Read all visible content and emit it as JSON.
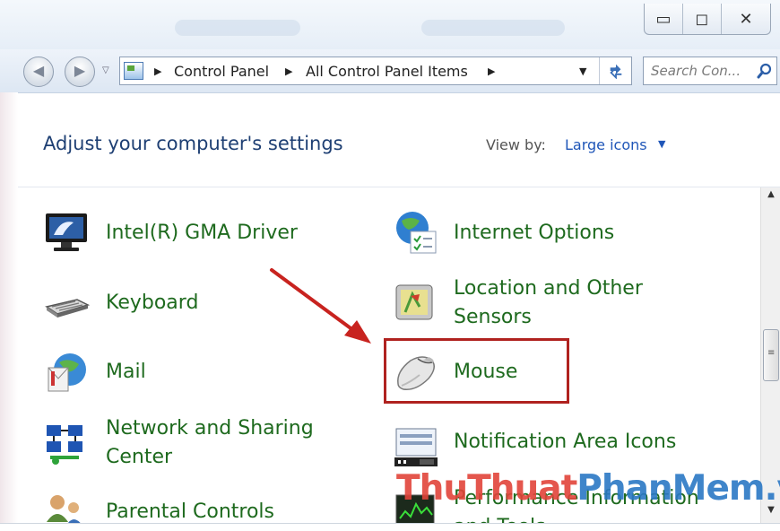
{
  "window": {
    "minimize_glyph": "▭",
    "maximize_glyph": "◻",
    "close_glyph": "✕"
  },
  "address_bar": {
    "breadcrumbs": [
      "Control Panel",
      "All Control Panel Items"
    ],
    "search_placeholder": "Search Con..."
  },
  "header": {
    "title": "Adjust your computer's settings",
    "view_by_label": "View by:",
    "view_by_value": "Large icons"
  },
  "items": {
    "intel_gma": "Intel(R) GMA Driver",
    "keyboard": "Keyboard",
    "mail": "Mail",
    "network_line1": "Network and Sharing",
    "network_line2": "Center",
    "parental": "Parental Controls",
    "internet_options": "Internet Options",
    "location_line1": "Location and Other",
    "location_line2": "Sensors",
    "mouse": "Mouse",
    "notification": "Notification Area Icons",
    "performance_line1": "Performance Information",
    "performance_line2": "and Tools"
  },
  "watermark": {
    "part1": "ThuThuat",
    "part2": "PhanMem",
    "part3": ".vn"
  },
  "colors": {
    "link_green": "#1e6a1e",
    "heading_blue": "#1e3f73",
    "highlight_red": "#b0221f"
  }
}
